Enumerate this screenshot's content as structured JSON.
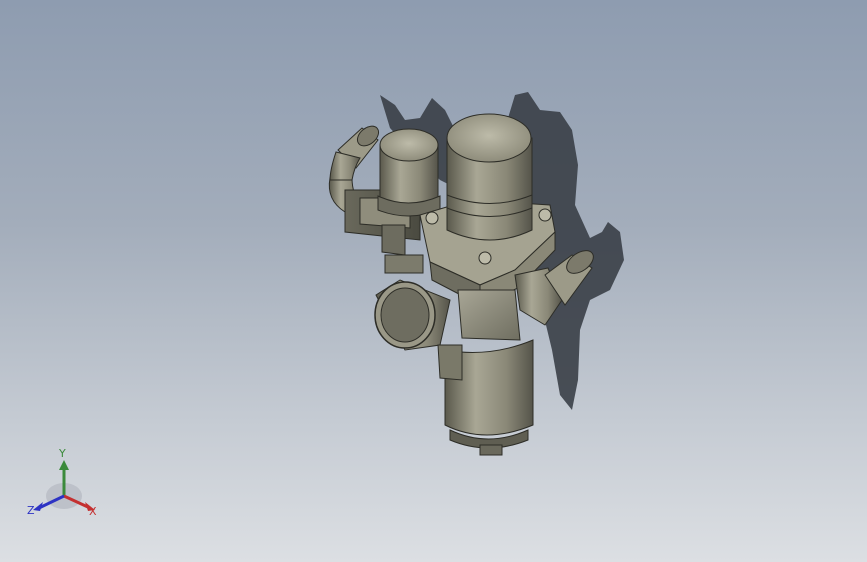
{
  "viewport": {
    "background_top": "#8e9cb0",
    "background_bottom": "#dcdfe3"
  },
  "model": {
    "body_color": "#8c8a78",
    "shadow_color": "#3a3f47"
  },
  "triad": {
    "x_label": "X",
    "y_label": "Y",
    "z_label": "Z",
    "x_color": "#c43030",
    "y_color": "#3b8a3b",
    "z_color": "#2d33c4"
  }
}
